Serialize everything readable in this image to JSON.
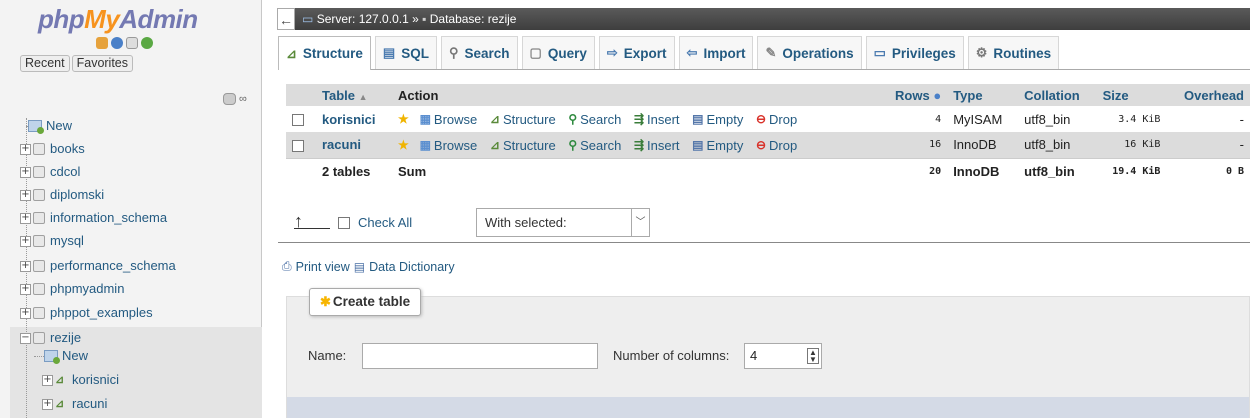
{
  "sidebar": {
    "logo": {
      "php": "php",
      "my": "My",
      "admin": "Admin"
    },
    "tab_recent": "Recent",
    "tab_favorites": "Favorites",
    "tree": [
      {
        "label": "New"
      },
      {
        "label": "books"
      },
      {
        "label": "cdcol"
      },
      {
        "label": "diplomski"
      },
      {
        "label": "information_schema"
      },
      {
        "label": "mysql"
      },
      {
        "label": "performance_schema"
      },
      {
        "label": "phpmyadmin"
      },
      {
        "label": "phppot_examples"
      },
      {
        "label": "rezije"
      }
    ],
    "rezije_children": [
      {
        "label": "New"
      },
      {
        "label": "korisnici"
      },
      {
        "label": "racuni"
      }
    ]
  },
  "breadcrumb": {
    "server": "Server: 127.0.0.1",
    "sep": "»",
    "database": "Database: rezije"
  },
  "tabs": [
    {
      "label": "Structure",
      "active": true
    },
    {
      "label": "SQL"
    },
    {
      "label": "Search"
    },
    {
      "label": "Query"
    },
    {
      "label": "Export"
    },
    {
      "label": "Import"
    },
    {
      "label": "Operations"
    },
    {
      "label": "Privileges"
    },
    {
      "label": "Routines"
    }
  ],
  "table": {
    "headers": {
      "table": "Table",
      "sort": "▲",
      "action": "Action",
      "rows": "Rows",
      "type": "Type",
      "collation": "Collation",
      "size": "Size",
      "overhead": "Overhead"
    },
    "actions": [
      "Browse",
      "Structure",
      "Search",
      "Insert",
      "Empty",
      "Drop"
    ],
    "rows": [
      {
        "name": "korisnici",
        "rows": "4",
        "type": "MyISAM",
        "collation": "utf8_bin",
        "size": "3.4 KiB",
        "overhead": "-"
      },
      {
        "name": "racuni",
        "rows": "16",
        "type": "InnoDB",
        "collation": "utf8_bin",
        "size": "16 KiB",
        "overhead": "-"
      }
    ],
    "summary": {
      "label": "2 tables",
      "sum": "Sum",
      "rows": "20",
      "type": "InnoDB",
      "collation": "utf8_bin",
      "size": "19.4 KiB",
      "overhead": "0 B"
    }
  },
  "bulk": {
    "check_all": "Check All",
    "with_selected": "With selected:"
  },
  "links": {
    "print_view": "Print view",
    "data_dictionary": "Data Dictionary"
  },
  "create_table": {
    "legend": "Create table",
    "name_label": "Name:",
    "name_value": "",
    "columns_label": "Number of columns:",
    "columns_value": "4"
  }
}
